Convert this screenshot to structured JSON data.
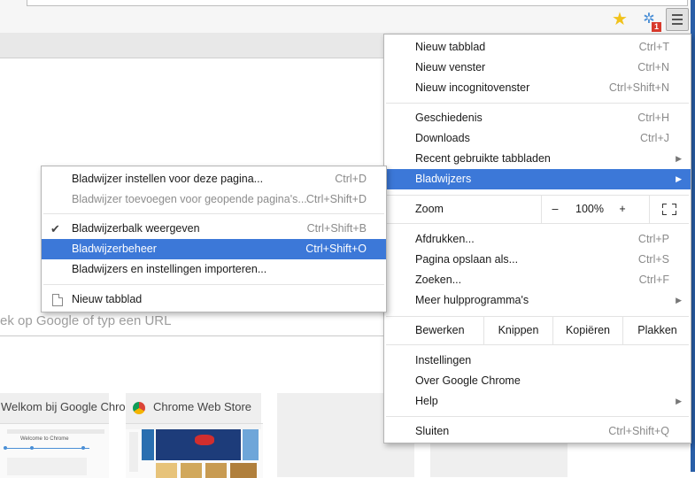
{
  "toolbar": {
    "star_icon": "star-icon",
    "extension_badge": "1",
    "menu_icon": "hamburger-menu-icon"
  },
  "page": {
    "search_hint": "ek op Google of typ een URL",
    "tiles": [
      {
        "title": "Welkom bij Google Chrome",
        "thumb_caption": "Welcome to Chrome"
      },
      {
        "title": "Chrome Web Store"
      },
      {
        "title": ""
      },
      {
        "title": ""
      }
    ]
  },
  "main_menu": {
    "items": [
      {
        "label": "Nieuw tabblad",
        "shortcut": "Ctrl+T"
      },
      {
        "label": "Nieuw venster",
        "shortcut": "Ctrl+N"
      },
      {
        "label": "Nieuw incognitovenster",
        "shortcut": "Ctrl+Shift+N"
      },
      {
        "label": "Geschiedenis",
        "shortcut": "Ctrl+H"
      },
      {
        "label": "Downloads",
        "shortcut": "Ctrl+J"
      },
      {
        "label": "Recent gebruikte tabbladen",
        "shortcut": ""
      },
      {
        "label": "Bladwijzers",
        "shortcut": ""
      },
      {
        "label": "Afdrukken...",
        "shortcut": "Ctrl+P"
      },
      {
        "label": "Pagina opslaan als...",
        "shortcut": "Ctrl+S"
      },
      {
        "label": "Zoeken...",
        "shortcut": "Ctrl+F"
      },
      {
        "label": "Meer hulpprogramma's",
        "shortcut": ""
      },
      {
        "label": "Instellingen",
        "shortcut": ""
      },
      {
        "label": "Over Google Chrome",
        "shortcut": ""
      },
      {
        "label": "Help",
        "shortcut": ""
      },
      {
        "label": "Sluiten",
        "shortcut": "Ctrl+Shift+Q"
      }
    ],
    "zoom": {
      "label": "Zoom",
      "minus": "–",
      "value": "100%",
      "plus": "+"
    },
    "edit": {
      "label": "Bewerken",
      "cut": "Knippen",
      "copy": "Kopiëren",
      "paste": "Plakken"
    },
    "highlighted": "Bladwijzers"
  },
  "bookmarks_submenu": {
    "items": [
      {
        "label": "Bladwijzer instellen voor deze pagina...",
        "shortcut": "Ctrl+D"
      },
      {
        "label": "Bladwijzer toevoegen voor geopende pagina's...",
        "shortcut": "Ctrl+Shift+D",
        "disabled": true
      },
      {
        "label": "Bladwijzerbalk weergeven",
        "shortcut": "Ctrl+Shift+B",
        "checked": true
      },
      {
        "label": "Bladwijzerbeheer",
        "shortcut": "Ctrl+Shift+O"
      },
      {
        "label": "Bladwijzers en instellingen importeren...",
        "shortcut": ""
      },
      {
        "label": "Nieuw tabblad",
        "shortcut": ""
      }
    ],
    "highlighted": "Bladwijzerbeheer"
  },
  "colors": {
    "highlight": "#3c78d8",
    "badge": "#d83a2c",
    "star": "#f1c21b"
  }
}
